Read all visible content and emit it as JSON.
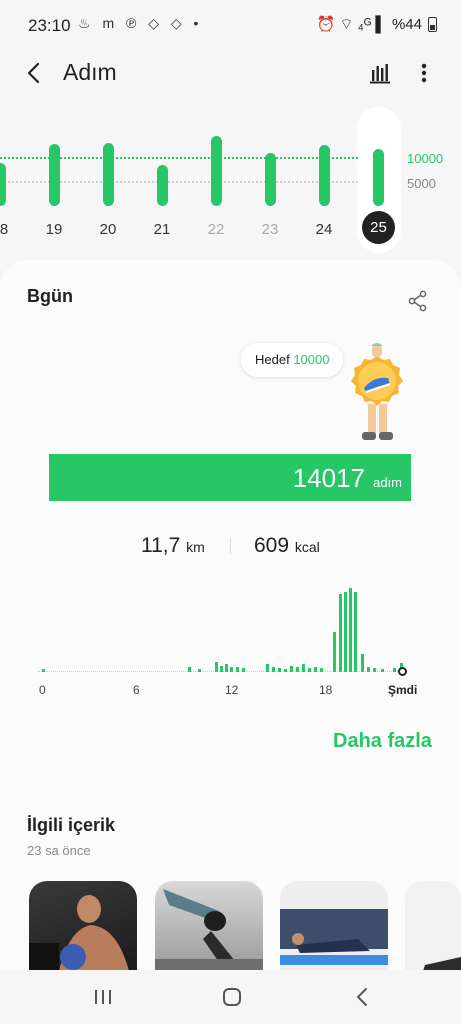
{
  "status": {
    "time": "23:10",
    "left_icons": "♨ m ℗ ◇ ◇ •",
    "right_icons": "⏰ ⌔ ₄ᴳ ▌",
    "battery": "%44"
  },
  "app": {
    "title": "Adım"
  },
  "week_chart": {
    "goal_label": "10000",
    "half_label": "5000",
    "days": [
      "8",
      "19",
      "20",
      "21",
      "22",
      "23",
      "24"
    ],
    "selected_day": "25",
    "muted_days": [
      "22",
      "23"
    ],
    "steps": [
      9000,
      13000,
      13200,
      8500,
      14500,
      11000,
      12800,
      11800
    ]
  },
  "today": {
    "title": "Bgün",
    "goal_prefix": "Hedef",
    "goal_value": "10000",
    "steps_value": "14017",
    "steps_unit": "adım",
    "distance_value": "11,7",
    "distance_unit": "km",
    "calories_value": "609",
    "calories_unit": "kcal",
    "hour_labels": [
      "0",
      "6",
      "12",
      "18"
    ],
    "now_label": "Şmdi",
    "more_label": "Daha fazla"
  },
  "related": {
    "title": "İlgili içerik",
    "subtitle": "23 sa önce",
    "thumbs": [
      "workout-kettlebell",
      "workout-stretch",
      "workout-plank",
      "workout-partial"
    ]
  },
  "colors": {
    "accent": "#27c768",
    "dark": "#222222"
  }
}
